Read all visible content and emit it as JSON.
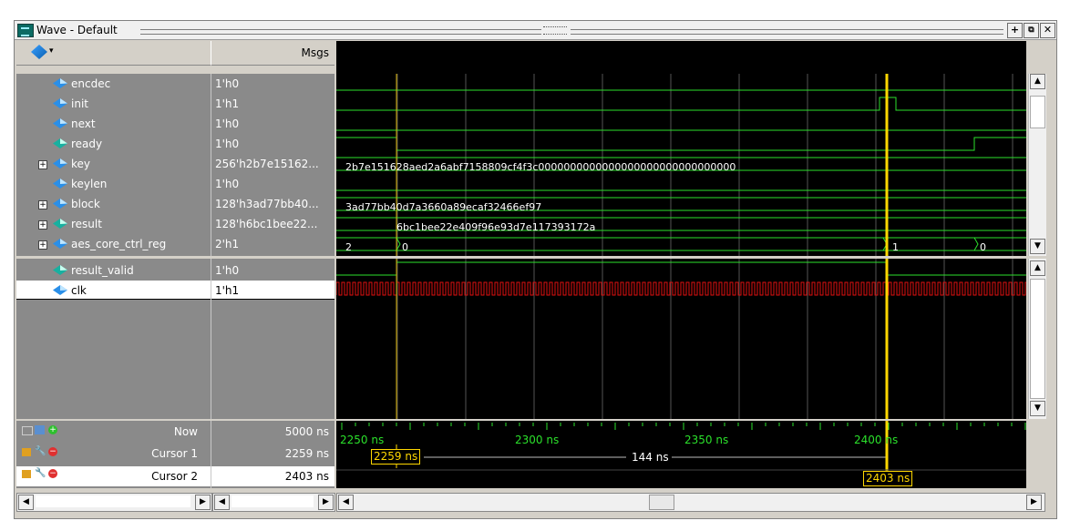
{
  "window": {
    "title": "Wave - Default"
  },
  "header": {
    "msgs_label": "Msgs"
  },
  "signals": [
    {
      "name": "encdec",
      "value": "1'h0"
    },
    {
      "name": "init",
      "value": "1'h1"
    },
    {
      "name": "next",
      "value": "1'h0"
    },
    {
      "name": "ready",
      "value": "1'h0"
    },
    {
      "name": "key",
      "value": "256'h2b7e15162..."
    },
    {
      "name": "keylen",
      "value": "1'h0"
    },
    {
      "name": "block",
      "value": "128'h3ad77bb40..."
    },
    {
      "name": "result",
      "value": "128'h6bc1bee22..."
    },
    {
      "name": "aes_core_ctrl_reg",
      "value": "2'h1"
    }
  ],
  "signals2": [
    {
      "name": "result_valid",
      "value": "1'h0"
    },
    {
      "name": "clk",
      "value": "1'h1"
    }
  ],
  "bus_values": {
    "key": "2b7e151628aed2a6abf7158809cf4f3c0000000000000000000000000000000",
    "block": "3ad77bb40d7a3660a89ecaf32466ef97",
    "result": "6bc1bee22e409f96e93d7e117393172a",
    "ctrl_a": "2",
    "ctrl_b": "0",
    "ctrl_c": "1",
    "ctrl_d": "0"
  },
  "footer": {
    "now_label": "Now",
    "now_value": "5000 ns",
    "cursor1_label": "Cursor 1",
    "cursor1_value": "2259 ns",
    "cursor2_label": "Cursor 2",
    "cursor2_value": "2403 ns",
    "delta": "144 ns",
    "ticks": [
      "2250 ns",
      "2300 ns",
      "2350 ns",
      "2400 ns"
    ],
    "cursor1_tag": "2259 ns",
    "cursor2_tag": "2403 ns"
  },
  "colors": {
    "wave_green": "#2be02b",
    "clk_red": "#e01010",
    "cursor_yellow": "#ffd700"
  }
}
